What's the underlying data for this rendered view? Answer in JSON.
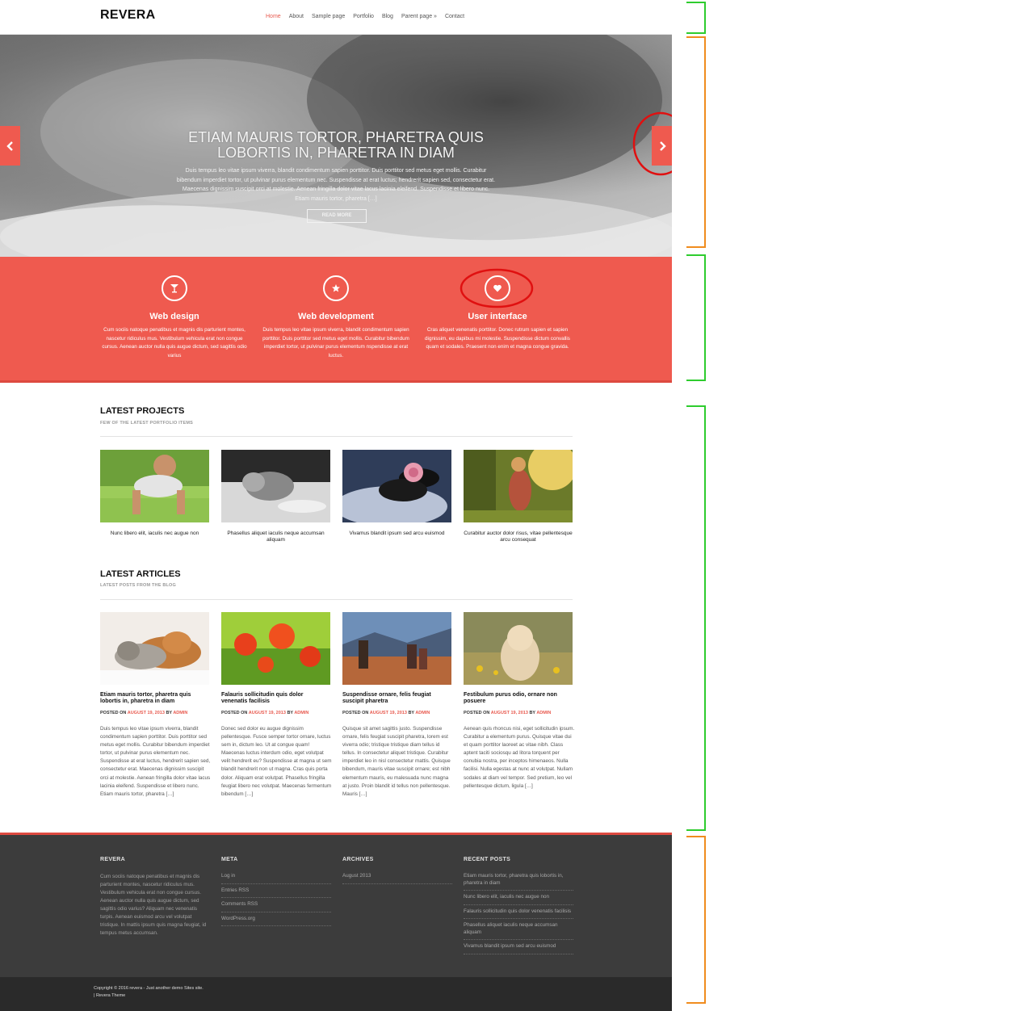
{
  "header": {
    "logo": "REVERA",
    "nav": [
      "Home",
      "About",
      "Sample page",
      "Portfolio",
      "Blog",
      "Parent page »",
      "Contact"
    ]
  },
  "hero": {
    "title": "ETIAM MAURIS TORTOR, PHARETRA QUIS LOBORTIS IN, PHARETRA IN DIAM",
    "text": "Duis tempus leo vitae ipsum viverra, blandit condimentum sapien porttitor. Duis porttitor sed metus eget mollis. Curabitur bibendum imperdiet tortor, ut pulvinar purus elementum nec. Suspendisse at erat luctus; hendrerit sapien sed, consectetur erat. Maecenas dignissim suscipit orci at molestie. Aenean fringilla dolor vitae lacus lacinia eleifend. Suspendisse et libero nunc. Etiam mauris tortor, pharetra […]",
    "button": "READ MORE"
  },
  "services": [
    {
      "icon": "cocktail-icon",
      "title": "Web design",
      "text": "Cum sociis natoque penatibus et magnis dis parturient montes, nascetur ridiculus mus. Vestibulum vehicula erat non congue cursus. Aenean auctor nulla quis augue dictum, sed sagittis odio varius"
    },
    {
      "icon": "star-icon",
      "title": "Web development",
      "text": "Duis tempus leo vitae ipsum viverra, blandit condimentum sapien porttitor. Duis porttitor sed metus eget mollis. Curabitur bibendum imperdiet tortor, ut pulvinar purus elementum nspendisse at erat luctus."
    },
    {
      "icon": "heart-icon",
      "title": "User interface",
      "text": "Cras aliquet venenatis porttitor. Donec rutrum sapien et sapien dignissim, eu dapibus mi molestie. Suspendisse dictum convallis quam et sodales. Praesent non enim et magna congue gravida."
    }
  ],
  "projects": {
    "title": "LATEST PROJECTS",
    "subtitle": "FEW OF THE LATEST PORTFOLIO ITEMS",
    "items": [
      {
        "caption": "Nunc libero elit, iaculis nec augue non"
      },
      {
        "caption": "Phasellus aliquet iaculis neque accumsan aliquam"
      },
      {
        "caption": "Vivamus blandit ipsum sed arcu euismod"
      },
      {
        "caption": "Curabitur auctor dolor risus, vitae pellentesque arcu consequat"
      }
    ]
  },
  "articles": {
    "title": "LATEST ARTICLES",
    "subtitle": "LATEST POSTS FROM THE BLOG",
    "posted_on": "POSTED ON",
    "by": "BY",
    "items": [
      {
        "title": "Etiam mauris tortor, pharetra quis lobortis in, pharetra in diam",
        "date": "AUGUST 19, 2013",
        "author": "ADMIN",
        "text": "Duis tempus leo vitae ipsum viverra, blandit condimentum sapien porttitor. Duis porttitor sed metus eget mollis. Curabitur bibendum imperdiet tortor, ut pulvinar purus elementum nec. Suspendisse at erat luctus, hendrerit sapien sed, consectetur erat. Maecenas dignissim suscipit orci at molestie. Aenean fringilla dolor vitae lacus lacinia eleifend. Suspendisse et libero nunc. Etiam mauris tortor, pharetra […]"
      },
      {
        "title": "Falauris sollicitudin quis dolor venenatis facilisis",
        "date": "AUGUST 19, 2013",
        "author": "ADMIN",
        "text": "Donec sed dolor eu augue dignissim pellentesque. Fusce semper tortor ornare, luctus sem in, dictum leo. Ut at congue quam! Maecenas luctus interdum odio, eget volutpat velit hendrerit eu? Suspendisse at magna ut sem blandit hendrerit non ut magna. Cras quis porta dolor. Aliquam erat volutpat. Phasellus fringilla feugiat libero nec volutpat. Maecenas fermentum bibendum […]"
      },
      {
        "title": "Suspendisse ornare, felis feugiat suscipit pharetra",
        "date": "AUGUST 19, 2013",
        "author": "ADMIN",
        "text": "Quisque sit amet sagittis justo. Suspendisse ornare, felis feugiat suscipit pharetra, lorem est viverra odio; tristique tristique diam tellus id tellus. In consectetur aliquet tristique. Curabitur imperdiet leo in nisl consectetur mattis. Quisque bibendum, mauris vitae suscipit ornare; est nibh elementum mauris, eu malesuada nunc magna at justo. Proin blandit id tellus non pellentesque. Mauris […]"
      },
      {
        "title": "Festibulum purus odio, ornare non posuere",
        "date": "AUGUST 19, 2013",
        "author": "ADMIN",
        "text": "Aenean quis rhoncus nisi, eget sollicitudin ipsum. Curabitur a elementum purus. Quisque vitae dui et quam porttitor laoreet ac vitae nibh. Class aptent taciti sociosqu ad litora torquent per conubia nostra, per inceptos himenaeos. Nulla facilisi. Nulla egestas at nunc at volutpat. Nullam sodales at diam vel tempor. Sed pretium, leo vel pellentesque dictum, ligula […]"
      }
    ]
  },
  "footer": {
    "about": {
      "title": "REVERA",
      "text": "Cum sociis natoque penatibus et magnis dis parturient montes, nascetur ridiculus mus. Vestibulum vehicula erat non congue cursus. Aenean auctor nulla quis augue dictum, sed sagittis odio varius? Aliquam nec venenatis turpis. Aenean euismod arcu vel volutpat tristique. In mattis ipsum quis magna feugiat, id tempus metus accumsan."
    },
    "meta": {
      "title": "META",
      "items": [
        "Log in",
        "Entries RSS",
        "Comments RSS",
        "WordPress.org"
      ]
    },
    "archives": {
      "title": "ARCHIVES",
      "items": [
        "August 2013"
      ]
    },
    "recent": {
      "title": "RECENT POSTS",
      "items": [
        "Etiam mauris tortor, pharetra quis lobortis in, pharetra in diam",
        "Nunc libero elit, iaculis nec augue non",
        "Falauris sollicitudin quis dolor venenatis facilisis",
        "Phasellus aliquet iaculis neque accumsan aliquam",
        "Vivamus blandit ipsum sed arcu euismod"
      ]
    },
    "copyright_line1": "Copyright © 2016 revera - Just another demo Sites site.",
    "copyright_line2": "| Revera Theme"
  },
  "colors": {
    "accent": "#ef5a4f",
    "footer_bg": "#3c3c3c",
    "annotation_green": "#2ecc2e",
    "annotation_orange": "#f08c1e",
    "annotation_red": "#e01010"
  }
}
